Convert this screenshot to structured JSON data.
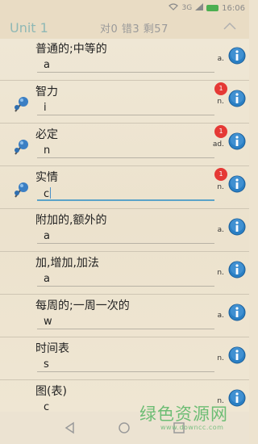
{
  "status_bar": {
    "signal_left": "3G",
    "time": "16:06"
  },
  "header": {
    "unit_title": "Unit 1",
    "stats": "对0 错3 剩57"
  },
  "rows": [
    {
      "word": "普通的;中等的",
      "answer": "a",
      "pos": "a.",
      "badge": null,
      "pinned": false
    },
    {
      "word": "智力",
      "answer": "i",
      "pos": "n.",
      "badge": "1",
      "pinned": true
    },
    {
      "word": "必定",
      "answer": "n",
      "pos": "ad.",
      "badge": "1",
      "pinned": true
    },
    {
      "word": "实情",
      "answer": "c",
      "pos": "n.",
      "badge": "1",
      "pinned": true
    },
    {
      "word": "附加的,额外的",
      "answer": "a",
      "pos": "a.",
      "badge": null,
      "pinned": false
    },
    {
      "word": "加,增加,加法",
      "answer": "a",
      "pos": "n.",
      "badge": null,
      "pinned": false
    },
    {
      "word": "每周的;一周一次的",
      "answer": "w",
      "pos": "a.",
      "badge": null,
      "pinned": false
    },
    {
      "word": "时间表",
      "answer": "s",
      "pos": "n.",
      "badge": null,
      "pinned": false
    },
    {
      "word": "图(表)",
      "answer": "c",
      "pos": "n.",
      "badge": null,
      "pinned": false
    }
  ],
  "watermark": {
    "text": "绿色资源网",
    "url": "www.downcc.com"
  },
  "colors": {
    "unit_title": "#8fb8b5",
    "badge": "#e53935",
    "info_blue": "#2a7fc4",
    "watermark": "#5fb96a"
  }
}
